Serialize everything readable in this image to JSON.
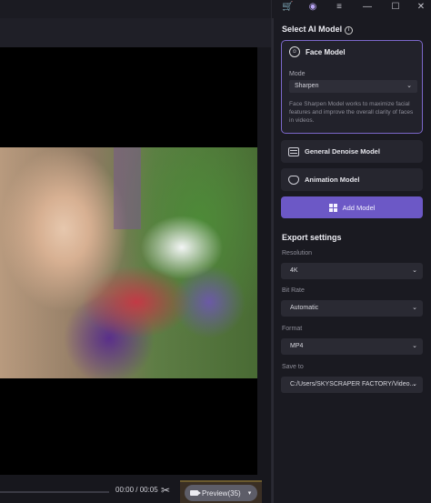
{
  "player": {
    "time": "00:00 / 00:05",
    "preview_label": "Preview(35)",
    "progress": 0.0
  },
  "titlebar": {
    "icons": [
      "cart-icon",
      "account-icon",
      "menu-icon",
      "minimize-icon",
      "maximize-icon",
      "close-icon"
    ]
  },
  "ai_model": {
    "title": "Select AI Model",
    "face_model": {
      "label": "Face Model",
      "mode_label": "Mode",
      "mode_value": "Sharpen",
      "description": "Face Sharpen Model works to maximize facial features and improve the overall clarity of faces in videos."
    },
    "general_denoise_label": "General Denoise Model",
    "animation_label": "Animation Model",
    "add_model_label": "Add Model"
  },
  "export": {
    "title": "Export settings",
    "resolution_label": "Resolution",
    "resolution_value": "4K",
    "bitrate_label": "Bit Rate",
    "bitrate_value": "Automatic",
    "format_label": "Format",
    "format_value": "MP4",
    "save_label": "Save to",
    "save_value": "C:/Users/SKYSCRAPER FACTORY/Video..."
  },
  "colors": {
    "accent": "#6c58c6",
    "card_border": "#7b67c9",
    "panel": "#1a1a21"
  }
}
